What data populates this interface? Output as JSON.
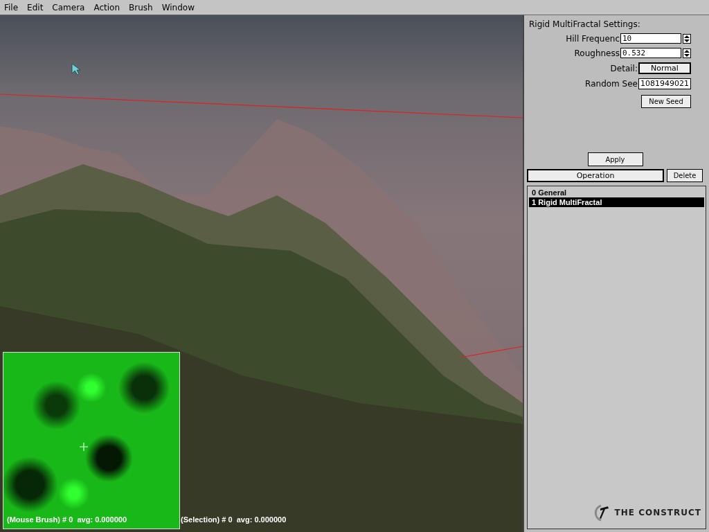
{
  "menu": [
    "File",
    "Edit",
    "Camera",
    "Action",
    "Brush",
    "Window"
  ],
  "settings": {
    "title": "Rigid MultiFractal Settings:",
    "fields": [
      {
        "kind": "spinner",
        "label": "Hill Frequenc",
        "value": "10"
      },
      {
        "kind": "spinner",
        "label": "Roughness",
        "value": "0.532"
      },
      {
        "kind": "choice",
        "label": "Detail:",
        "value": "Normal"
      },
      {
        "kind": "text",
        "label": "Random See",
        "value": "1081949021"
      }
    ],
    "new_seed_button": "New Seed"
  },
  "apply_button": "Apply",
  "operation_field": "Operation",
  "delete_button": "Delete",
  "operations": [
    {
      "label": "0 General",
      "selected": false
    },
    {
      "label": "1 Rigid MultiFractal",
      "selected": true
    }
  ],
  "logo": "THE CONSTRUCT",
  "status": {
    "mouse_brush": "(Mouse Brush) # 0  avg: 0.000000",
    "selection": "(Selection) # 0  avg: 0.000000"
  }
}
